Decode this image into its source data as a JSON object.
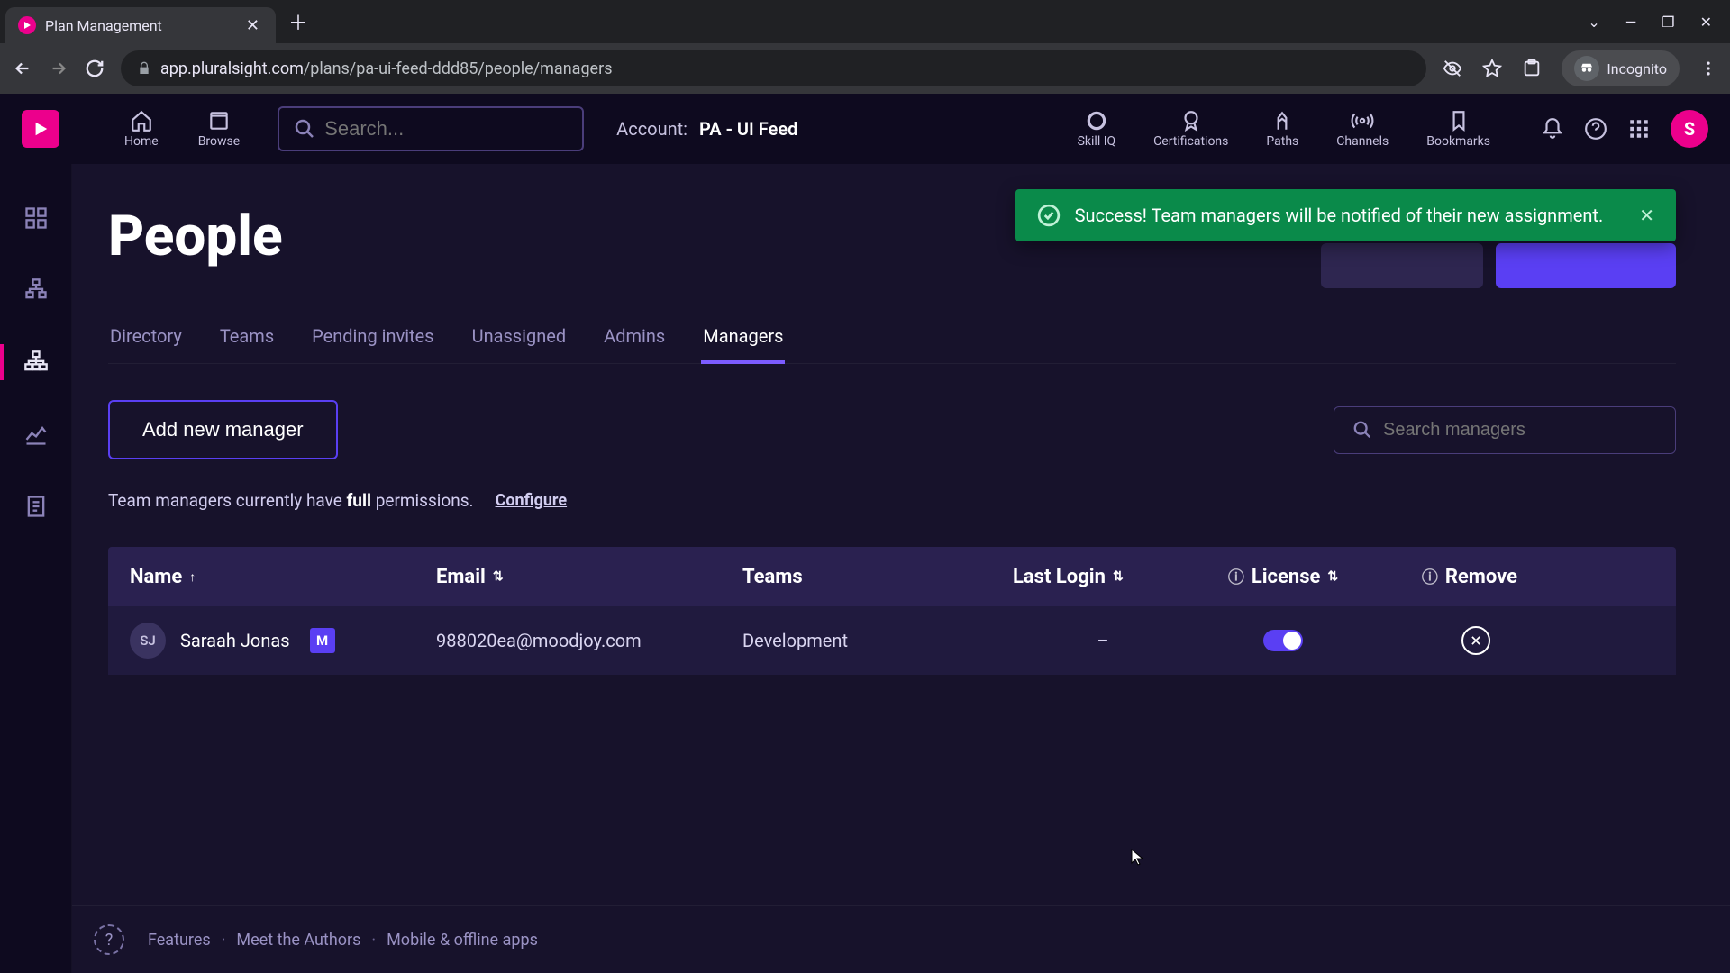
{
  "browser": {
    "tab_title": "Plan Management",
    "url_host": "app.pluralsight.com",
    "url_path": "/plans/pa-ui-feed-ddd85/people/managers",
    "incognito_label": "Incognito"
  },
  "header": {
    "nav": {
      "home": "Home",
      "browse": "Browse",
      "skilliq": "Skill IQ",
      "certs": "Certifications",
      "paths": "Paths",
      "channels": "Channels",
      "bookmarks": "Bookmarks"
    },
    "search_placeholder": "Search...",
    "account_label": "Account:",
    "account_name": "PA - UI Feed",
    "avatar_initial": "S"
  },
  "page": {
    "title": "People"
  },
  "toast": {
    "message": "Success! Team managers will be notified of their new assignment."
  },
  "tabs": {
    "directory": "Directory",
    "teams": "Teams",
    "pending": "Pending invites",
    "unassigned": "Unassigned",
    "admins": "Admins",
    "managers": "Managers"
  },
  "toolbar": {
    "add_manager": "Add new manager",
    "search_placeholder": "Search managers"
  },
  "permissions": {
    "prefix": "Team managers currently have ",
    "bold": "full",
    "suffix": " permissions.",
    "configure": "Configure"
  },
  "table": {
    "columns": {
      "name": "Name",
      "email": "Email",
      "teams": "Teams",
      "last_login": "Last Login",
      "license": "License",
      "remove": "Remove"
    },
    "rows": [
      {
        "initials": "SJ",
        "name": "Saraah Jonas",
        "badge": "M",
        "email": "988020ea@moodjoy.com",
        "teams": "Development",
        "last_login": "–",
        "license_on": true
      }
    ]
  },
  "footer": {
    "features": "Features",
    "authors": "Meet the Authors",
    "mobile": "Mobile & offline apps"
  }
}
